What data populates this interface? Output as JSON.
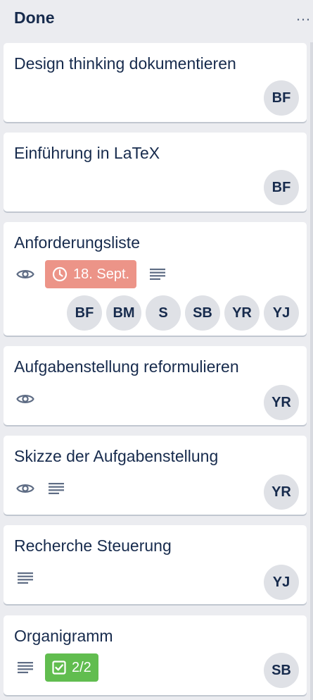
{
  "list": {
    "title": "Done",
    "menu_label": "…"
  },
  "cards": [
    {
      "title": "Design thinking dokumentieren",
      "members": [
        "BF"
      ]
    },
    {
      "title": "Einführung in LaTeX",
      "members": [
        "BF"
      ]
    },
    {
      "title": "Anforderungsliste",
      "due": "18. Sept.",
      "members": [
        "BF",
        "BM",
        "S",
        "SB",
        "YR",
        "YJ"
      ]
    },
    {
      "title": "Aufgabenstellung reformulieren",
      "members": [
        "YR"
      ]
    },
    {
      "title": "Skizze der Aufgabenstellung",
      "members": [
        "YR"
      ]
    },
    {
      "title": "Recherche Steuerung",
      "members": [
        "YJ"
      ]
    },
    {
      "title": "Organigramm",
      "checklist": "2/2",
      "members": [
        "SB"
      ]
    }
  ],
  "colors": {
    "due_overdue": "#ec9488",
    "checklist_complete": "#61bd4f",
    "avatar_bg": "#dfe1e6",
    "text": "#172b4d",
    "icon": "#5e6c84"
  },
  "icons": {
    "watch": "eye-icon",
    "description": "description-lines-icon",
    "due": "clock-icon",
    "checklist": "checkbox-icon"
  }
}
